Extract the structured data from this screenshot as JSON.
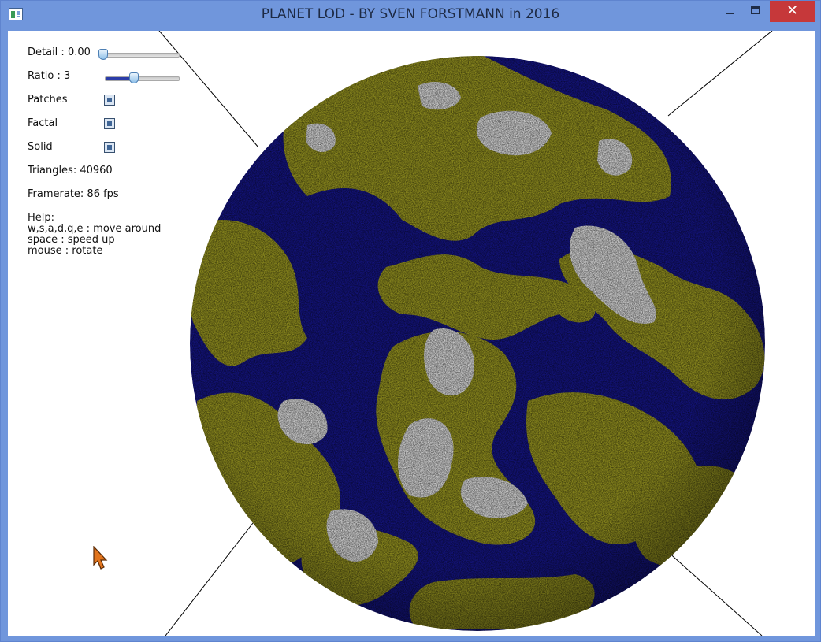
{
  "window": {
    "title": "PLANET LOD - BY SVEN FORSTMANN in 2016",
    "close_glyph": "✕"
  },
  "controls": {
    "detail": {
      "label": "Detail : 0.00",
      "value": 0.0
    },
    "ratio": {
      "label": "Ratio : 3",
      "value": 0.25
    },
    "patches": {
      "label": "Patches",
      "checked": true
    },
    "factal": {
      "label": "Factal",
      "checked": true
    },
    "solid": {
      "label": "Solid",
      "checked": true
    }
  },
  "stats": {
    "triangles": "Triangles: 40960",
    "framerate": "Framerate: 86 fps"
  },
  "help": {
    "title": "Help:",
    "lines": [
      "w,s,a,d,q,e : move around",
      "space : speed up",
      "mouse : rotate"
    ]
  },
  "colors": {
    "ocean": "#14147e",
    "land": "#8b8b1e",
    "mountain": "#d2d2d2",
    "accent": "#c6383a"
  }
}
